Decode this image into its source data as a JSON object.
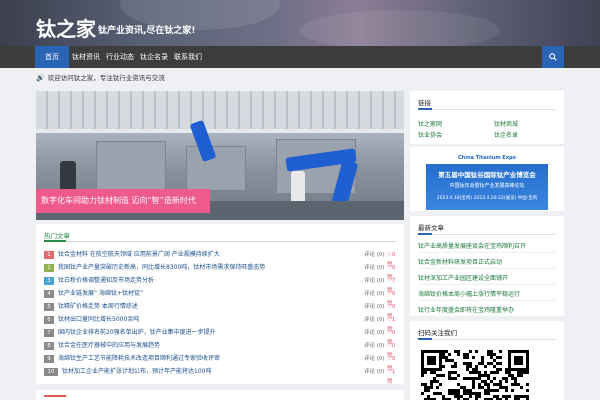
{
  "site": {
    "name": "钛之家",
    "slogan": "钛产业资讯,尽在钛之家!"
  },
  "nav": {
    "items": [
      "首页",
      "钛材资讯",
      "行业动态",
      "钛企名录",
      "联系我们"
    ],
    "active_index": 0,
    "search_icon": "search-icon"
  },
  "notice": {
    "icon": "speaker-icon",
    "text": "欢迎访问钛之家，专注钛行业资讯与交流"
  },
  "hero": {
    "caption": "数字化车间助力钛材制造 迈向“智”造新时代"
  },
  "list": {
    "title": "热门文章",
    "items": [
      {
        "num": "1",
        "color": "#e36b6b",
        "title": "钛合金材料 在航空航天领域 应用前景广阔 产业规模持续扩大",
        "comments": "评论 (0)",
        "likes": "♡0赞"
      },
      {
        "num": "2",
        "color": "#8fb14f",
        "title": "我国钛产业产量突破历史新高，同比增长8300吨，钛材市场需求保持旺盛态势",
        "comments": "评论 (0)",
        "likes": "♡0赞"
      },
      {
        "num": "3",
        "color": "#4aa3d8",
        "title": "钛白粉价格调整通知及市场走势分析",
        "comments": "评论 (0)",
        "likes": "♡7赞"
      },
      {
        "num": "4",
        "color": "#8a8a8a",
        "title": "钛产业链发展“ 海绵钛+钛材锭”",
        "comments": "评论 (0)",
        "likes": "♡0赞"
      },
      {
        "num": "5",
        "color": "#8a8a8a",
        "title": "钛精矿价格走势 本周行情综述",
        "comments": "评论 (0)",
        "likes": "♡0赞"
      },
      {
        "num": "6",
        "color": "#8a8a8a",
        "title": "钛材出口量同比增长5000余吨",
        "comments": "评论 (0)",
        "likes": "♡1赞"
      },
      {
        "num": "7",
        "color": "#8a8a8a",
        "title": "国内钛企业排名前20强名单出炉，钛产业集中度进一步提升",
        "comments": "评论 (0)",
        "likes": "♡0赞"
      },
      {
        "num": "8",
        "color": "#8a8a8a",
        "title": "钛合金在医疗器械中的应用与发展趋势",
        "comments": "评论 (0)",
        "likes": "♡0赞"
      },
      {
        "num": "9",
        "color": "#8a8a8a",
        "title": "海绵钛生产工艺节能降耗技术改造项目顺利通过专家验收评审",
        "comments": "评论 (0)",
        "likes": "♡0赞"
      },
      {
        "num": "10",
        "color": "#8a8a8a",
        "title": "钛材加工企业产能扩张计划公布，预计年产能将达100吨",
        "comments": "评论 (0)",
        "likes": "♡1赞"
      }
    ]
  },
  "sidebar": {
    "links_title": "链接",
    "links": [
      "钛之家网",
      "钛材商城",
      "钛业协会",
      "钛企名录"
    ],
    "expo": {
      "brand": "China Titanium Expo",
      "title": "第五届中国钛谷国际钛产业博览会",
      "subtitle": "中国钛年会暨钛产业发展高峰论坛",
      "date": "2023.4.18(宝鸡)   2023.4.20-22(展览)   中国·宝鸡"
    },
    "news_title": "最新文章",
    "news": [
      "钛产业高质量发展座谈会在宝鸡顺利召开",
      "钛合金新材料研发项目正式启动",
      "钛材深加工产业园区建设全面铺开",
      "海绵钛价格本周小幅上涨行情平稳运行",
      "钛行业年度盛会即将在宝鸡隆重举办"
    ],
    "qr_title": "扫码关注我们"
  },
  "colors": {
    "accent_blue": "#2a65b5",
    "accent_green": "#2a8a4a",
    "caption_pink": "#ee5a8c"
  }
}
